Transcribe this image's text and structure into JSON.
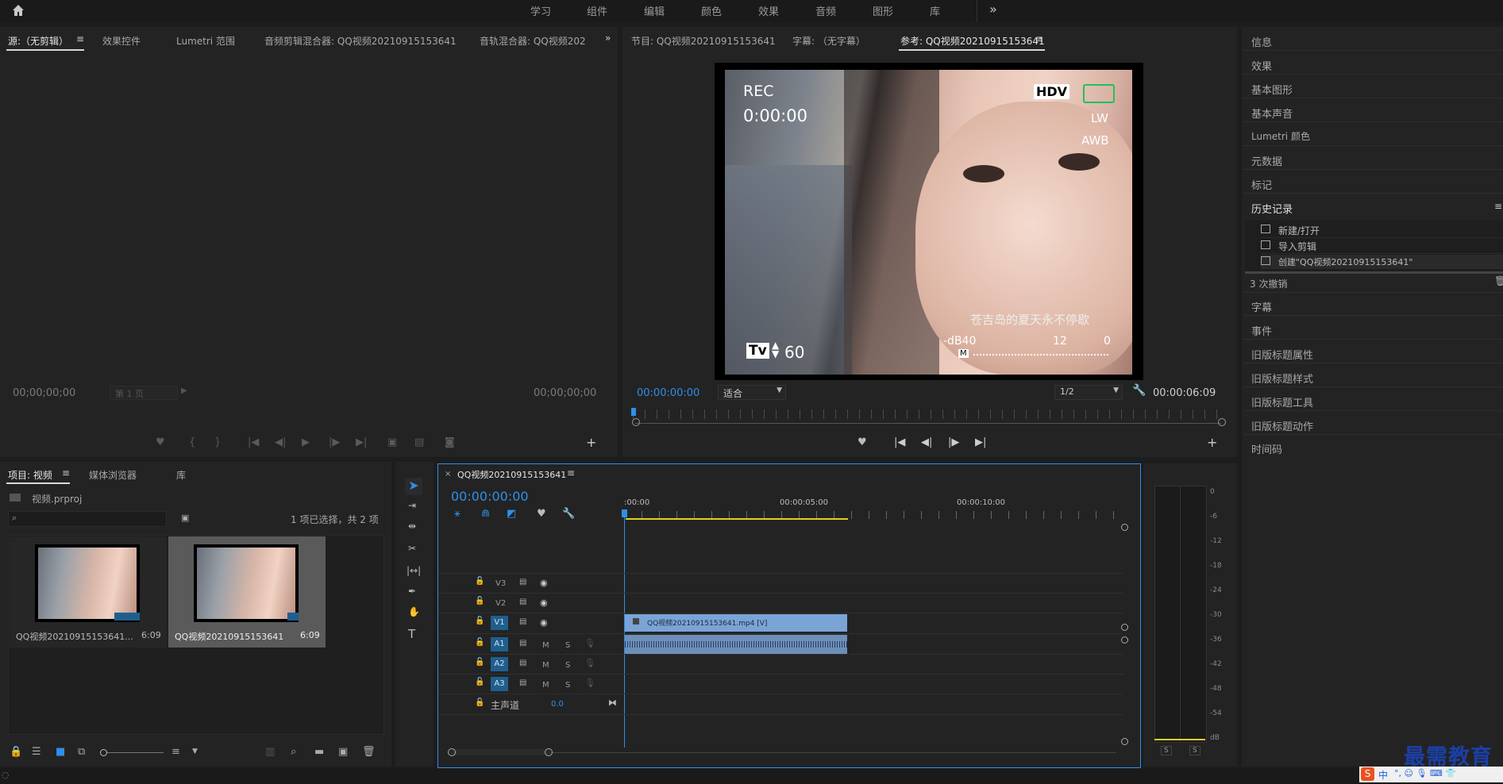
{
  "topnav": {
    "items": [
      "学习",
      "组件",
      "编辑",
      "颜色",
      "效果",
      "音频",
      "图形",
      "库"
    ],
    "more": "»"
  },
  "source_panel": {
    "tabs": [
      "源:（无剪辑）",
      "效果控件",
      "Lumetri 范围",
      "音频剪辑混合器: QQ视频20210915153641",
      "音轨混合器: QQ视频202"
    ],
    "timecode_left": "00;00;00;00",
    "page": "第 1 页",
    "timecode_right": "00;00;00;00"
  },
  "program_panel": {
    "tabs": [
      "节目: QQ视频20210915153641",
      "字幕: （无字幕）",
      "参考: QQ视频20210915153641"
    ],
    "timecode_left": "00:00:00:00",
    "fit": "适合",
    "resolution": "1/2",
    "timecode_right": "00:00:06:09",
    "overlay": {
      "rec": "REC",
      "rec_time": "0:00:00",
      "hdv": "HDV",
      "lw": "LW",
      "awb": "AWB",
      "subtitle": "苍吉岛的夏天永不停歇",
      "db": "-dB40",
      "db_12": "12",
      "db_0": "0",
      "m": "M",
      "tv": "Tv",
      "tv_val": "60"
    }
  },
  "project_panel": {
    "tabs": [
      "项目: 视频",
      "媒体浏览器",
      "库"
    ],
    "file": "视频.prproj",
    "status": "1 项已选择，共 2 项",
    "items": [
      {
        "name": "QQ视频20210915153641...",
        "duration": "6:09"
      },
      {
        "name": "QQ视频20210915153641",
        "duration": "6:09"
      }
    ]
  },
  "timeline": {
    "title": "QQ视频20210915153641",
    "timecode": "00:00:00:00",
    "ruler": [
      ":00:00",
      "00:00:05:00",
      "00:00:10:00"
    ],
    "tracks": [
      {
        "id": "V3",
        "type": "video"
      },
      {
        "id": "V2",
        "type": "video"
      },
      {
        "id": "V1",
        "type": "video"
      },
      {
        "id": "A1",
        "type": "audio"
      },
      {
        "id": "A2",
        "type": "audio"
      },
      {
        "id": "A3",
        "type": "audio"
      }
    ],
    "master_label": "主声道",
    "master_value": "0.0",
    "clip_video": "QQ视频20210915153641.mp4 [V]",
    "m": "M",
    "s": "S"
  },
  "meter": {
    "ticks": [
      "0",
      "-6",
      "-12",
      "-18",
      "-24",
      "-30",
      "-36",
      "-42",
      "-48",
      "-54",
      "dB"
    ],
    "s": "S"
  },
  "right_panel": {
    "items": [
      "信息",
      "效果",
      "基本图形",
      "基本声音",
      "Lumetri 颜色",
      "元数据",
      "标记",
      "历史记录"
    ],
    "history": [
      "新建/打开",
      "导入剪辑",
      "创建\"QQ视频20210915153641\""
    ],
    "undo": "3 次撤销",
    "items2": [
      "字幕",
      "事件",
      "旧版标题属性",
      "旧版标题样式",
      "旧版标题工具",
      "旧版标题动作",
      "时间码"
    ]
  },
  "watermark": "最需教育",
  "ime": "中"
}
